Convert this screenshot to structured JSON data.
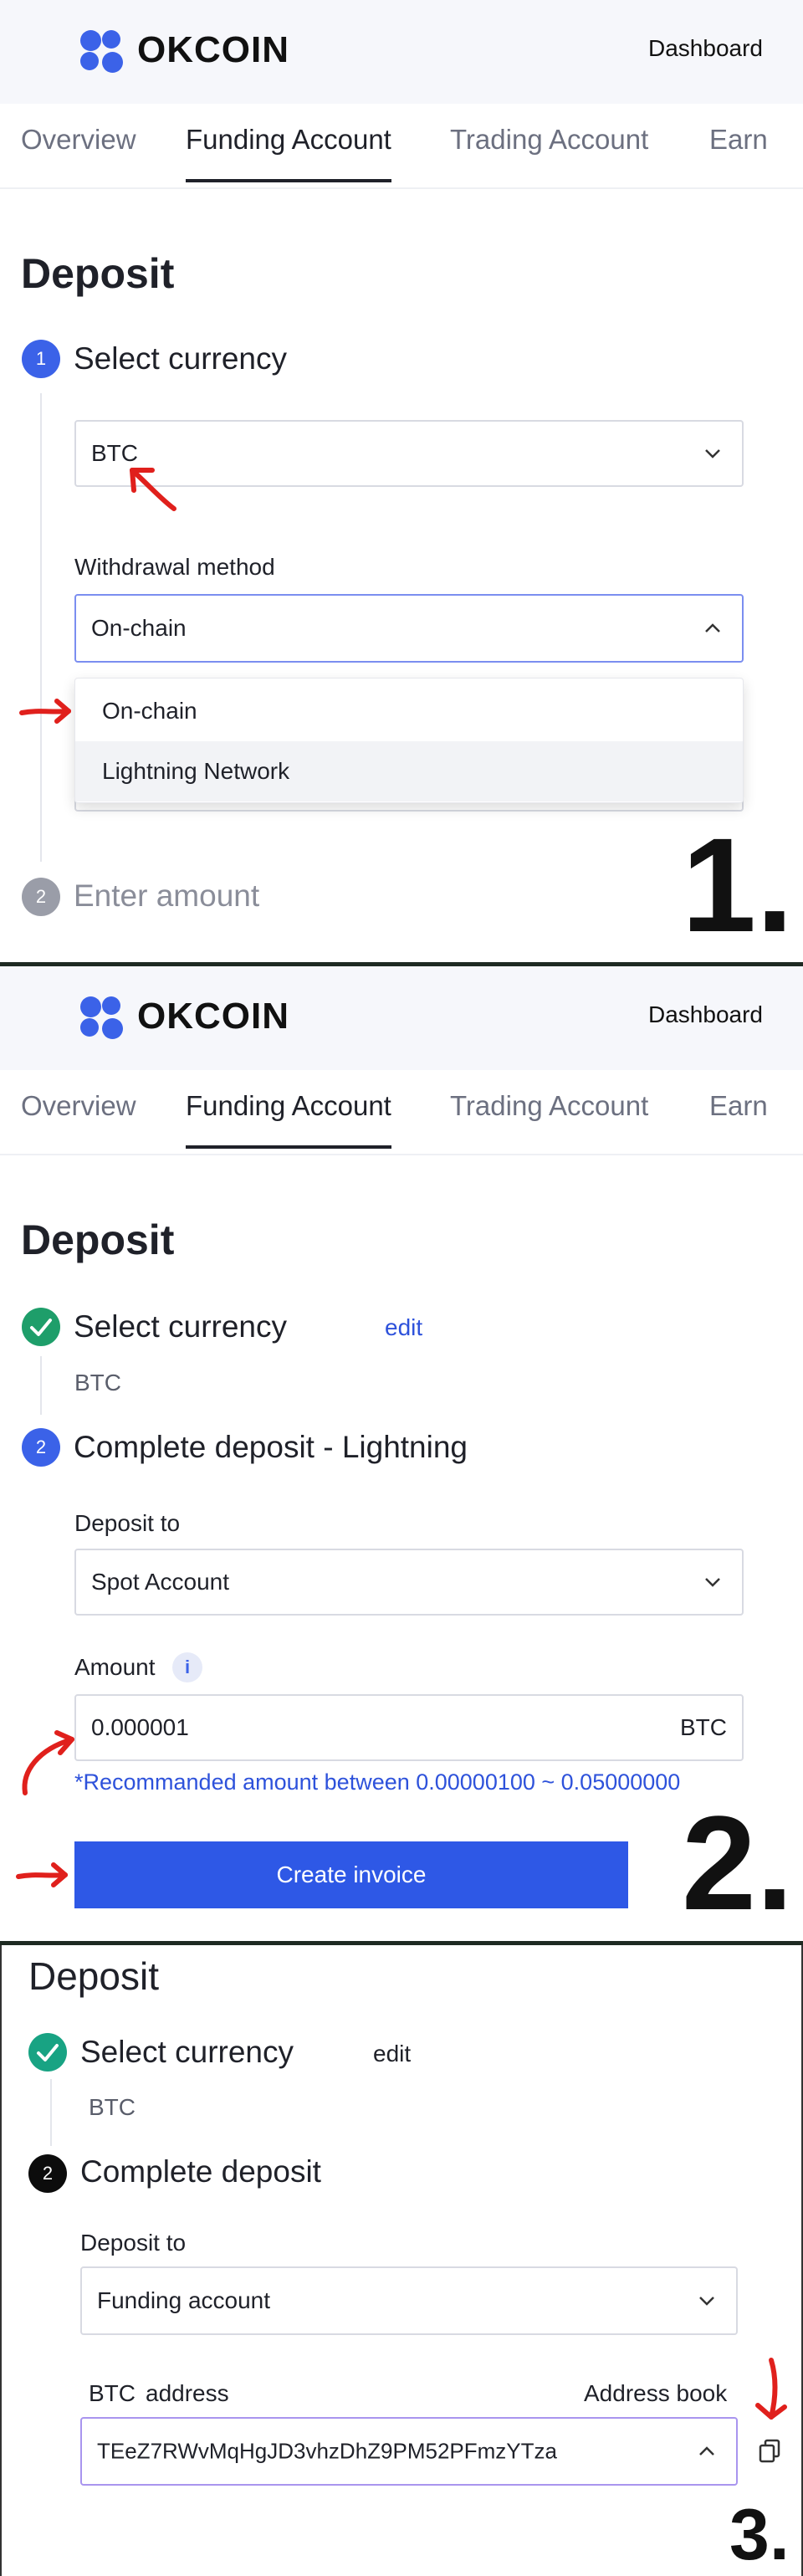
{
  "header": {
    "logo_text": "OKCOIN",
    "dashboard_link": "Dashboard"
  },
  "tabs": [
    {
      "label": "Overview"
    },
    {
      "label": "Funding Account"
    },
    {
      "label": "Trading Account"
    },
    {
      "label": "Earn"
    }
  ],
  "panel1": {
    "title": "Deposit",
    "step1_number": "1",
    "step1_label": "Select currency",
    "currency_value": "BTC",
    "method_label": "Withdrawal method",
    "method_value": "On-chain",
    "method_options": [
      "On-chain",
      "Lightning Network"
    ],
    "step2_number": "2",
    "step2_label": "Enter amount",
    "marker": "1."
  },
  "panel2": {
    "title": "Deposit",
    "step1_label": "Select currency",
    "edit_label": "edit",
    "currency_value": "BTC",
    "step2_number": "2",
    "step2_label": "Complete deposit - Lightning",
    "deposit_to_label": "Deposit to",
    "deposit_to_value": "Spot Account",
    "amount_label": "Amount",
    "info_glyph": "i",
    "amount_value": "0.000001",
    "amount_unit": "BTC",
    "hint": "*Recommanded amount between 0.00000100 ~ 0.05000000",
    "create_button": "Create invoice",
    "marker": "2."
  },
  "panel3": {
    "title": "Deposit",
    "step1_label": "Select currency",
    "edit_label": "edit",
    "currency_value": "BTC",
    "step2_number": "2",
    "step2_label": "Complete deposit",
    "deposit_to_label": "Deposit to",
    "deposit_to_value": "Funding account",
    "address_currency": "BTC",
    "address_label": "address",
    "address_book": "Address book",
    "address_value": "TEeZ7RWvMqHgJD3vhzDhZ9PM52PFmzYTza",
    "marker": "3."
  },
  "colors": {
    "accent_blue": "#2e58e6",
    "step_active": "#3b62e8",
    "step_inactive": "#9a9da8",
    "success_green": "#1e9e6a",
    "annotation_red": "#e0201c"
  },
  "icons": [
    "chevron-down-icon",
    "chevron-up-icon",
    "check-icon",
    "info-icon",
    "copy-icon",
    "red-arrow-icon"
  ]
}
